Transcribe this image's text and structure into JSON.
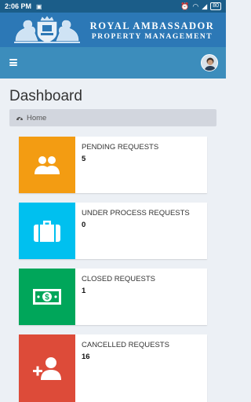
{
  "status": {
    "time": "2:06 PM",
    "battery": "80"
  },
  "brand": {
    "line1": "ROYAL AMBASSADOR",
    "line2": "PROPERTY MANAGEMENT"
  },
  "page": {
    "title": "Dashboard",
    "breadcrumb": "Home"
  },
  "cards": [
    {
      "label": "PENDING REQUESTS",
      "count": "5",
      "color": "#f39c12",
      "icon": "users-icon"
    },
    {
      "label": "UNDER PROCESS REQUESTS",
      "count": "0",
      "color": "#00c0ef",
      "icon": "suitcase-icon"
    },
    {
      "label": "CLOSED REQUESTS",
      "count": "1",
      "color": "#00a65a",
      "icon": "money-icon"
    },
    {
      "label": "CANCELLED REQUESTS",
      "count": "16",
      "color": "#dd4b39",
      "icon": "user-plus-icon"
    }
  ]
}
